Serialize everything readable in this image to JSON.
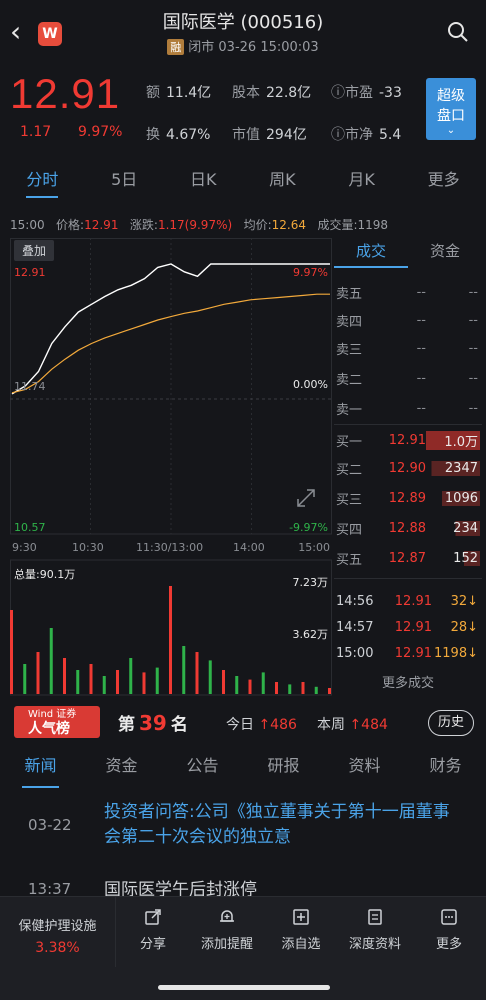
{
  "header": {
    "title": "国际医学 (000516)",
    "badge": "融",
    "status": "闭市 03-26 15:00:03",
    "app_icon_letter": "W"
  },
  "quote": {
    "price": "12.91",
    "change": "1.17",
    "change_pct": "9.97%",
    "stats": [
      {
        "k": "额",
        "v": "11.4亿"
      },
      {
        "k": "股本",
        "v": "22.8亿"
      },
      {
        "k": "ⓘ市盈",
        "v": "-33"
      },
      {
        "k": "换",
        "v": "4.67%"
      },
      {
        "k": "市值",
        "v": "294亿"
      },
      {
        "k": "ⓘ市净",
        "v": "5.4"
      }
    ],
    "super_btn": "超级\n盘口"
  },
  "period_tabs": [
    "分时",
    "5日",
    "日K",
    "周K",
    "月K",
    "更多"
  ],
  "info_line": {
    "time": "15:00",
    "price_label": "价格:",
    "price": "12.91",
    "chg_label": "涨跌:",
    "chg": "1.17(9.97%)",
    "avg_label": "均价:",
    "avg": "12.64",
    "vol_label": "成交量:",
    "vol": "1198"
  },
  "chart": {
    "overlay_tag": "叠加",
    "top_price": "12.91",
    "top_pct": "9.97%",
    "mid_price": "11.74",
    "mid_pct": "0.00%",
    "bot_price": "10.57",
    "bot_pct": "-9.97%",
    "times": [
      "9:30",
      "10:30",
      "11:30/13:00",
      "14:00",
      "15:00"
    ],
    "vol_total": "总量:90.1万",
    "vol_max": "7.23万",
    "vol_mid": "3.62万"
  },
  "chart_data": {
    "type": "line",
    "xlabel": "",
    "ylabel": "",
    "ylim": [
      10.57,
      12.91
    ],
    "x": [
      "9:30",
      "9:40",
      "9:50",
      "10:00",
      "10:10",
      "10:20",
      "10:30",
      "10:40",
      "10:50",
      "11:00",
      "11:10",
      "11:20",
      "11:30",
      "13:10",
      "13:20",
      "13:30",
      "13:40",
      "13:50",
      "14:00",
      "14:10",
      "14:20",
      "14:30",
      "14:40",
      "14:50",
      "15:00"
    ],
    "series": [
      {
        "name": "价格",
        "values": [
          11.75,
          11.82,
          11.95,
          12.2,
          12.35,
          12.48,
          12.55,
          12.62,
          12.68,
          12.72,
          12.78,
          12.88,
          12.91,
          12.84,
          12.8,
          12.91,
          12.91,
          12.91,
          12.91,
          12.91,
          12.91,
          12.91,
          12.91,
          12.91,
          12.91
        ]
      },
      {
        "name": "均价",
        "values": [
          11.76,
          11.79,
          11.86,
          11.97,
          12.06,
          12.14,
          12.2,
          12.25,
          12.29,
          12.33,
          12.37,
          12.41,
          12.44,
          12.47,
          12.49,
          12.52,
          12.55,
          12.57,
          12.59,
          12.6,
          12.61,
          12.62,
          12.63,
          12.64,
          12.64
        ]
      }
    ],
    "volume": {
      "max": "7.23万",
      "mid": "3.62万"
    }
  },
  "right_panel": {
    "tabs": [
      "成交",
      "资金"
    ],
    "asks": [
      {
        "label": "卖五",
        "price": "--",
        "vol": "--"
      },
      {
        "label": "卖四",
        "price": "--",
        "vol": "--"
      },
      {
        "label": "卖三",
        "price": "--",
        "vol": "--"
      },
      {
        "label": "卖二",
        "price": "--",
        "vol": "--"
      },
      {
        "label": "卖一",
        "price": "--",
        "vol": "--"
      }
    ],
    "bids": [
      {
        "label": "买一",
        "price": "12.91",
        "vol": "1.0万"
      },
      {
        "label": "买二",
        "price": "12.90",
        "vol": "2347"
      },
      {
        "label": "买三",
        "price": "12.89",
        "vol": "1096"
      },
      {
        "label": "买四",
        "price": "12.88",
        "vol": "234"
      },
      {
        "label": "买五",
        "price": "12.87",
        "vol": "152"
      }
    ],
    "trades": [
      {
        "time": "14:56",
        "price": "12.91",
        "vol": "32↓"
      },
      {
        "time": "14:57",
        "price": "12.91",
        "vol": "28↓"
      },
      {
        "time": "15:00",
        "price": "12.91",
        "vol": "1198↓"
      }
    ],
    "more_trades": "更多成交"
  },
  "rank": {
    "badge_top": "Wind 证券",
    "badge_main": "人气榜",
    "prefix": "第",
    "num": "39",
    "suffix": "名",
    "today_label": "今日",
    "today_val": "↑486",
    "week_label": "本周",
    "week_val": "↑484",
    "history": "历史"
  },
  "news_tabs": [
    "新闻",
    "资金",
    "公告",
    "研报",
    "资料",
    "财务"
  ],
  "news": [
    {
      "date": "03-22",
      "headline": "投资者问答:公司《独立董事关于第十一届董事会第二十次会议的独立意"
    },
    {
      "date": "13:37",
      "headline": "国际医学午后封涨停"
    }
  ],
  "bottom": {
    "sector_name": "保健护理设施",
    "sector_pct": "3.38%",
    "tools": [
      "分享",
      "添加提醒",
      "添自选",
      "深度资料",
      "更多"
    ]
  }
}
